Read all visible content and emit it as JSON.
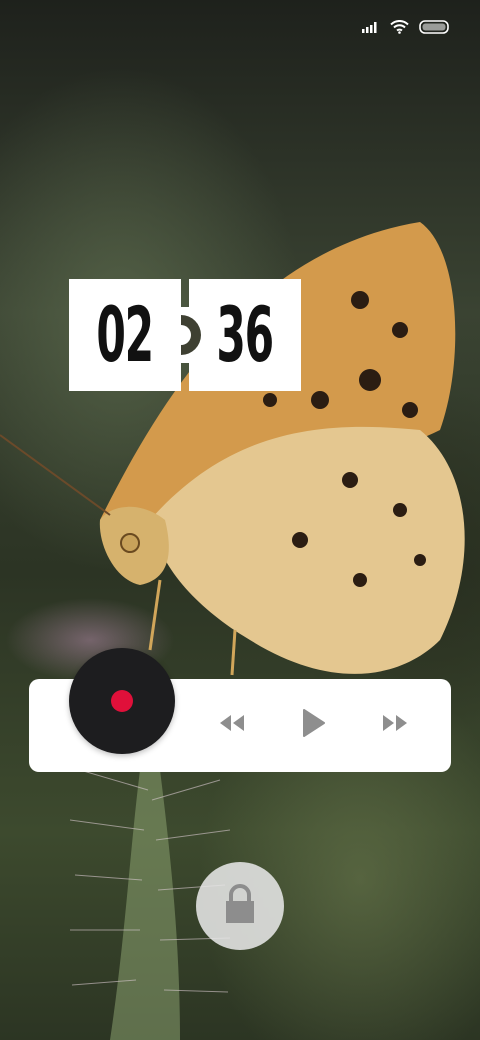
{
  "status_bar": {
    "signal_icon": "signal-bars-icon",
    "wifi_icon": "wifi-icon",
    "battery_icon": "battery-icon"
  },
  "clock": {
    "hours": "02",
    "minutes": "36"
  },
  "media_player": {
    "album_art_icon": "vinyl-record-icon",
    "controls": {
      "previous_icon": "rewind-icon",
      "play_icon": "play-icon",
      "next_icon": "fast-forward-icon"
    },
    "accent_color": "#e0103a",
    "control_color": "#8e8e8e"
  },
  "lock": {
    "icon": "lock-icon"
  }
}
